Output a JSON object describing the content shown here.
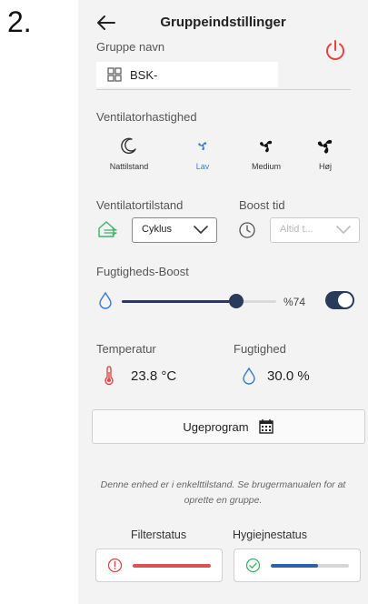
{
  "step_number": "2.",
  "header": {
    "title": "Gruppeindstillinger"
  },
  "group": {
    "label": "Gruppe navn",
    "value": "BSK-"
  },
  "fan_speed": {
    "label": "Ventilatorhastighed",
    "options": [
      {
        "label": "Nattilstand",
        "active": false
      },
      {
        "label": "Lav",
        "active": true
      },
      {
        "label": "Medium",
        "active": false
      },
      {
        "label": "Høj",
        "active": false
      }
    ]
  },
  "mode": {
    "label": "Ventilatortilstand",
    "value": "Cyklus"
  },
  "boost_time": {
    "label": "Boost tid",
    "value": "Altid t..."
  },
  "humidity_boost": {
    "label": "Fugtigheds-Boost",
    "value_text": "%74",
    "level_percent": 74,
    "enabled": true
  },
  "temperature": {
    "label": "Temperatur",
    "value": "23.8 °C"
  },
  "humidity": {
    "label": "Fugtighed",
    "value": "30.0 %"
  },
  "week_program": {
    "label": "Ugeprogram"
  },
  "info_text": "Denne enhed er i enkelttilstand. Se brugermanualen for at oprette en gruppe.",
  "filter_status": {
    "label": "Filterstatus",
    "level_percent": 100,
    "color": "#e05050"
  },
  "hygiene_status": {
    "label": "Hygiejnestatus",
    "level_percent": 60,
    "color": "#2e62a8"
  },
  "colors": {
    "accent": "#3a7bd5",
    "dark": "#2a3a5a",
    "alert": "#e04848",
    "ok": "#3bb56a"
  }
}
